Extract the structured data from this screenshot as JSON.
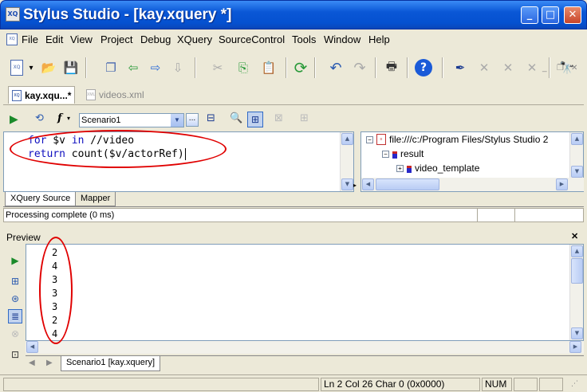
{
  "window": {
    "title": "Stylus Studio - [kay.xquery *]",
    "min_label": "_",
    "max_label": "□",
    "close_label": "✕"
  },
  "menu": {
    "items": [
      "File",
      "Edit",
      "View",
      "Project",
      "Debug",
      "XQuery",
      "SourceControl",
      "Tools",
      "Window",
      "Help"
    ],
    "mdi_min": "_",
    "mdi_restore": "❐",
    "mdi_close": "✕"
  },
  "doc_tabs": [
    {
      "label": "kay.xqu...*",
      "active": true
    },
    {
      "label": "videos.xml",
      "active": false
    }
  ],
  "editor_toolbar": {
    "scenario_select": "Scenario1",
    "scenario_browse": "..."
  },
  "editor": {
    "lines": [
      {
        "kw": "for",
        "rest": " $v ",
        "kw2": "in",
        "rest2": " //video"
      },
      {
        "kw": "return",
        "rest": " count($v/actorRef)",
        "kw2": "",
        "rest2": ""
      }
    ]
  },
  "tree": {
    "root": "file:///c:/Program Files/Stylus Studio 2",
    "children": [
      {
        "label": "result",
        "expander": "−"
      },
      {
        "label": "video_template",
        "expander": "+"
      }
    ]
  },
  "source_tabs": [
    "XQuery Source",
    "Mapper"
  ],
  "status_message": "Processing complete (0 ms)",
  "preview": {
    "title": "Preview",
    "close_label": "✕",
    "results": [
      "2",
      "4",
      "3",
      "3",
      "3",
      "2",
      "4"
    ],
    "bottom_tab": "Scenario1 [kay.xquery]"
  },
  "statusbar": {
    "position": "Ln 2 Col 26  Char 0 (0x0000)",
    "num": "NUM"
  },
  "colors": {
    "titlebar": "#0a57d6",
    "keyword": "#1010c0",
    "annotation": "#e00000"
  }
}
